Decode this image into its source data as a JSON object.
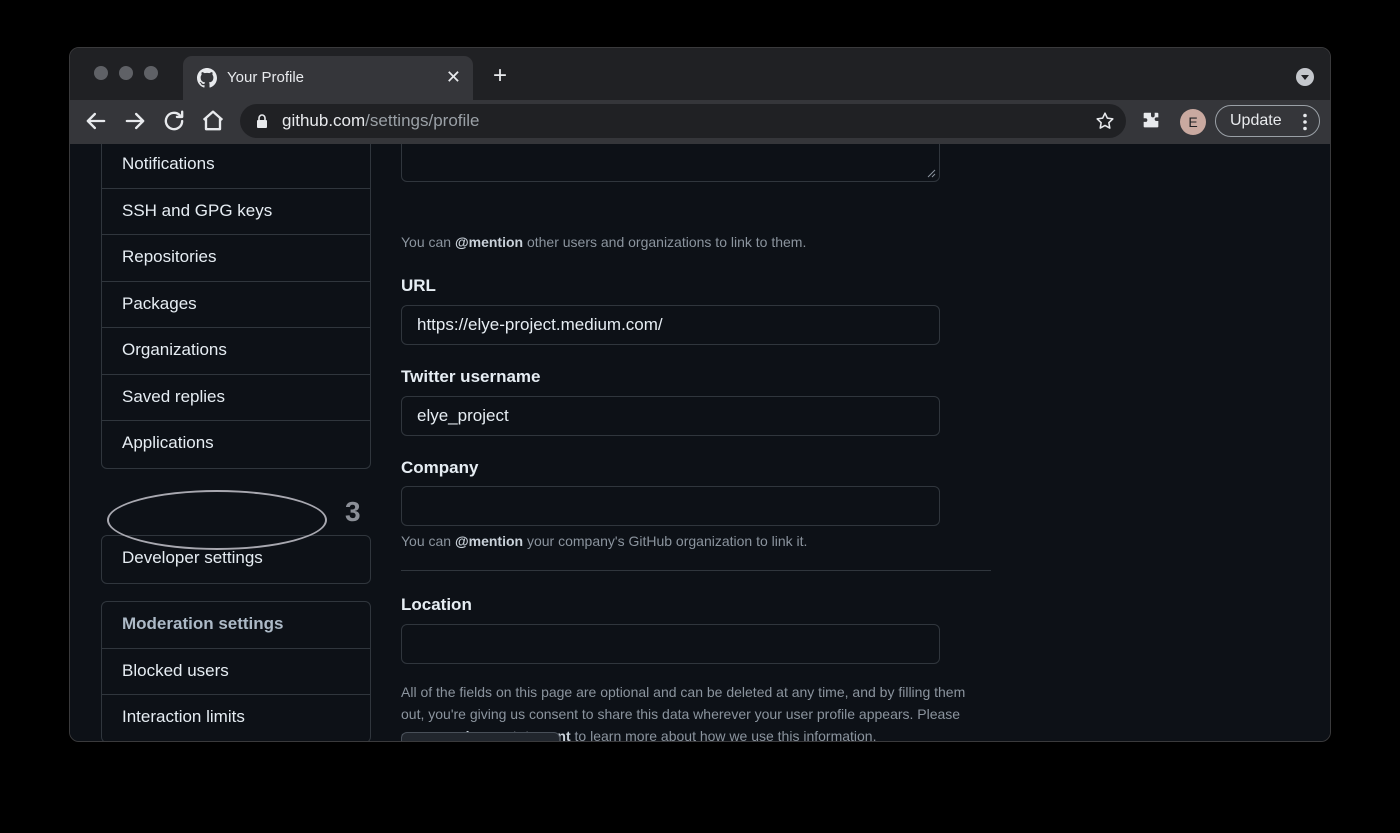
{
  "browser": {
    "tab_title": "Your Profile",
    "url_host": "github.com",
    "url_path": "/settings/profile",
    "avatar_initial": "E",
    "update_label": "Update"
  },
  "sidebar": {
    "group1": [
      "Notifications",
      "SSH and GPG keys",
      "Repositories",
      "Packages",
      "Organizations",
      "Saved replies",
      "Applications"
    ],
    "developer_settings": "Developer settings",
    "annotation_step": "3",
    "moderation_heading": "Moderation settings",
    "moderation_items": [
      "Blocked users",
      "Interaction limits"
    ]
  },
  "form": {
    "bio_hint_pre": "You can ",
    "bio_hint_mention": "@mention",
    "bio_hint_post": " other users and organizations to link to them.",
    "url_label": "URL",
    "url_value": "https://elye-project.medium.com/",
    "twitter_label": "Twitter username",
    "twitter_value": "elye_project",
    "company_label": "Company",
    "company_value": "",
    "company_hint_pre": "You can ",
    "company_hint_mention": "@mention",
    "company_hint_post": " your company's GitHub organization to link it.",
    "location_label": "Location",
    "location_value": "",
    "footer_pre": "All of the fields on this page are optional and can be deleted at any time, and by filling them out, you're giving us consent to share this data wherever your user profile appears. Please see our ",
    "footer_link": "privacy statement",
    "footer_post": " to learn more about how we use this information."
  },
  "colors": {
    "background": "#0d1117",
    "border": "#30363d",
    "text": "#e6edf3",
    "muted": "#8b949e"
  }
}
